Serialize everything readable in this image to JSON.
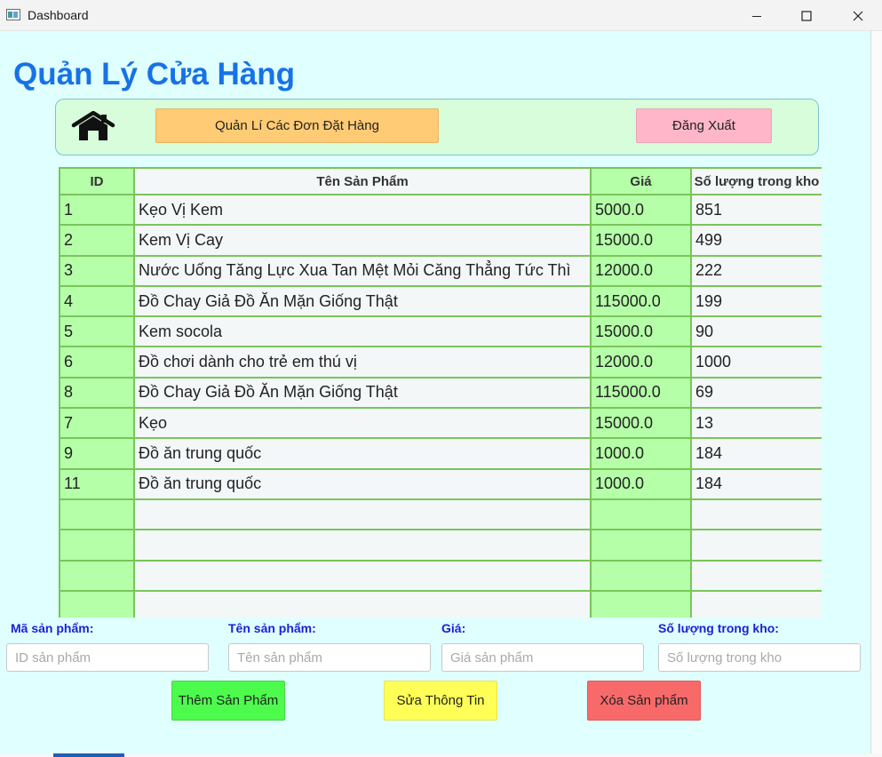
{
  "window": {
    "title": "Dashboard",
    "controls": [
      "minimize-icon",
      "maximize-icon",
      "close-icon"
    ]
  },
  "header": {
    "title": "Quản Lý Cửa Hàng"
  },
  "nav": {
    "home_icon": "home-icon",
    "orders_label": "Quản Lí Các Đơn Đặt Hàng",
    "logout_label": "Đăng Xuất"
  },
  "table": {
    "columns": [
      "ID",
      "Tên Sản Phẩm",
      "Giá",
      "Số lượng trong kho"
    ],
    "rows": [
      {
        "id": "1",
        "name": "Kẹo Vị Kem",
        "price": "5000.0",
        "qty": "851"
      },
      {
        "id": "2",
        "name": "Kem Vị Cay",
        "price": "15000.0",
        "qty": "499"
      },
      {
        "id": "3",
        "name": "Nước Uống Tăng Lực Xua Tan Mệt Mỏi Căng Thẳng Tức Thì",
        "price": "12000.0",
        "qty": "222"
      },
      {
        "id": "4",
        "name": "Đồ Chay Giả Đồ Ăn Mặn Giống Thật",
        "price": "115000.0",
        "qty": "199"
      },
      {
        "id": "5",
        "name": "Kem socola",
        "price": "15000.0",
        "qty": "90"
      },
      {
        "id": "6",
        "name": "Đồ chơi dành cho trẻ em thú vị",
        "price": "12000.0",
        "qty": "1000"
      },
      {
        "id": "8",
        "name": "Đồ Chay Giả Đồ Ăn Mặn Giống Thật",
        "price": "115000.0",
        "qty": "69"
      },
      {
        "id": "7",
        "name": "Kẹo",
        "price": "15000.0",
        "qty": "13"
      },
      {
        "id": "9",
        "name": "Đồ ăn trung quốc",
        "price": "1000.0",
        "qty": "184"
      },
      {
        "id": "11",
        "name": "Đồ ăn trung quốc",
        "price": "1000.0",
        "qty": "184"
      }
    ]
  },
  "form": {
    "id_label": "Mã sản phẩm:",
    "id_placeholder": "ID sản phẩm",
    "id_value": "",
    "name_label": "Tên sản phẩm:",
    "name_placeholder": "Tên sản phẩm",
    "name_value": "",
    "price_label": "Giá:",
    "price_placeholder": "Giá sản phẩm",
    "price_value": "",
    "qty_label": "Số lượng trong kho:",
    "qty_placeholder": "Số lượng trong kho",
    "qty_value": ""
  },
  "actions": {
    "add_label": "Thêm Sản Phẩm",
    "edit_label": "Sửa Thông Tin",
    "delete_label": "Xóa Sản phẩm"
  },
  "colors": {
    "title": "#1672e6",
    "client_bg": "#e0ffff",
    "nav_bg": "#d7fddb",
    "orders_button": "#ffcc75",
    "logout_button": "#ffb6c8",
    "green_column": "#b5ffa8",
    "grid_line": "#7ac55a",
    "form_label": "#1b22d6",
    "add_button": "#4cfb4c",
    "edit_button": "#ffff58",
    "delete_button": "#f86a6a"
  }
}
